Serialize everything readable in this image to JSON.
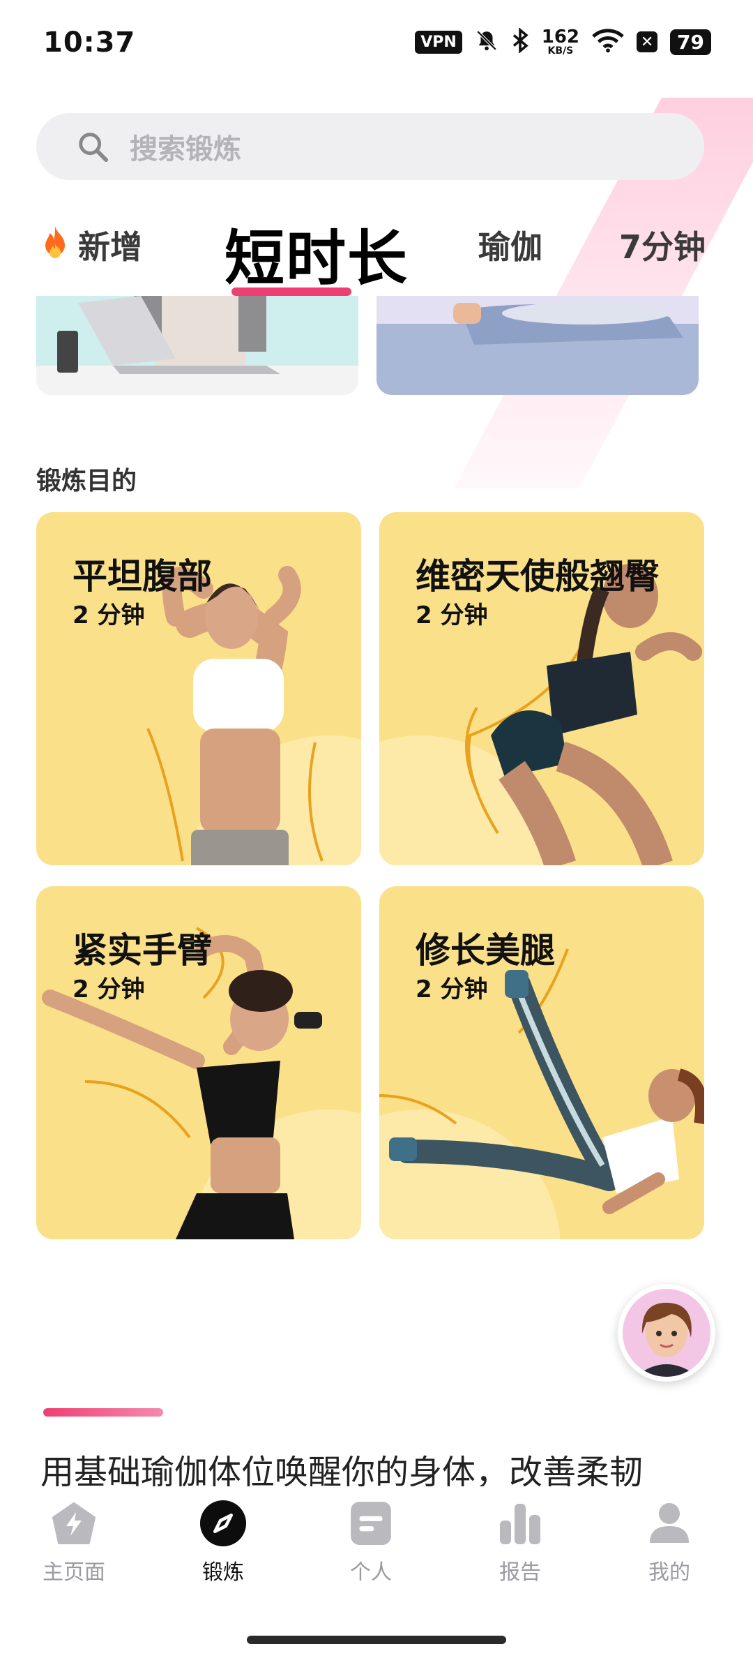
{
  "status_bar": {
    "time": "10:37",
    "vpn": "VPN",
    "net_speed_value": "162",
    "net_speed_unit": "KB/S",
    "battery": "79",
    "icons": [
      "mute-bell-icon",
      "bluetooth-icon",
      "wifi-icon",
      "close-box-icon",
      "battery-icon"
    ]
  },
  "search": {
    "placeholder": "搜索锻炼"
  },
  "tabs": [
    {
      "label": "新增",
      "icon": "fire-icon"
    },
    {
      "label": "短时长",
      "active": true
    },
    {
      "label": "瑜伽"
    },
    {
      "label": "7分钟"
    }
  ],
  "section": {
    "title": "锻炼目的"
  },
  "cards": [
    {
      "title": "平坦腹部",
      "duration": "2 分钟"
    },
    {
      "title": "维密天使般翘臀",
      "duration": "2 分钟"
    },
    {
      "title": "紧实手臂",
      "duration": "2 分钟"
    },
    {
      "title": "修长美腿",
      "duration": "2 分钟"
    }
  ],
  "promo": {
    "text": "用基础瑜伽体位唤醒你的身体，改善柔韧"
  },
  "bottom_nav": [
    {
      "label": "主页面",
      "icon": "home-bolt-icon"
    },
    {
      "label": "锻炼",
      "icon": "compass-icon",
      "active": true
    },
    {
      "label": "个人",
      "icon": "notes-icon"
    },
    {
      "label": "报告",
      "icon": "bar-chart-icon"
    },
    {
      "label": "我的",
      "icon": "profile-icon"
    }
  ],
  "colors": {
    "accent": "#ee3f72",
    "card_background": "#fbe08a",
    "nav_inactive": "#9a9aa0"
  }
}
